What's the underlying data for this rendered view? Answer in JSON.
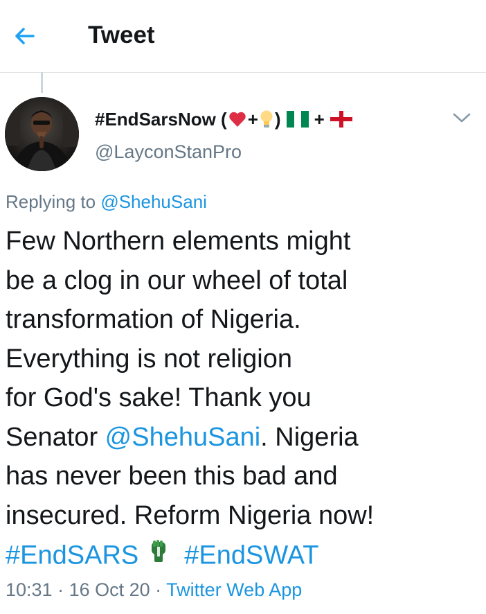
{
  "header": {
    "title": "Tweet",
    "back_icon": "arrow-left-icon",
    "accent": "#1da1f2"
  },
  "author": {
    "display_name_prefix": "#EndSarsNow (",
    "display_name_mid": ")",
    "display_name_plus": "+",
    "display_name_plus2": "+",
    "name_icons": [
      "heart-icon",
      "lightbulb-icon",
      "nigeria-flag-icon",
      "england-flag-icon"
    ],
    "handle": "@LayconStanPro"
  },
  "reply": {
    "prefix": "Replying to",
    "mention": "@ShehuSani"
  },
  "tweet": {
    "line1": "Few Northern elements might",
    "line2": "be a clog in our wheel of total",
    "line3": "transformation of Nigeria.",
    "line4": "Everything is not religion",
    "line5": "for God's sake! Thank you",
    "line6_pre": "Senator ",
    "line6_mention": "@ShehuSani",
    "line6_post": ". Nigeria",
    "line7": "has never been this bad and",
    "line8": "insecured. Reform Nigeria now!",
    "hashtag1": "#EndSARS",
    "hashtag2": "#EndSWAT",
    "fist_icon": "raised-fist-icon"
  },
  "meta": {
    "time": "10:31",
    "separator1": " · ",
    "date": "16 Oct 20",
    "separator2": " · ",
    "source": "Twitter Web App"
  },
  "colors": {
    "link": "#1b95e0",
    "secondary_text": "#657786",
    "primary_text": "#14171a"
  }
}
